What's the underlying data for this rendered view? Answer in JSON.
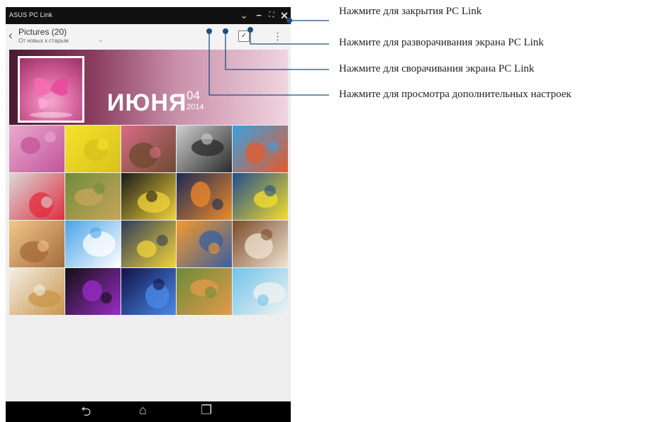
{
  "window": {
    "title": "ASUS PC Link",
    "buttons": {
      "collapse": "⌄",
      "minimize": "−",
      "maximize": "⛶",
      "close": "✕"
    }
  },
  "action_bar": {
    "back_icon": "‹",
    "title": "Pictures (20)",
    "subtitle": "От новых к старым",
    "sort_icon": "⌄",
    "select_icon": "✓",
    "overflow_icon": "⋮"
  },
  "banner": {
    "month": "ИЮНЯ",
    "day": "04",
    "year": "2014"
  },
  "gallery": {
    "tiles": [
      {
        "name": "pink-butterflies",
        "colors": [
          "#e9a9cf",
          "#c2559a"
        ]
      },
      {
        "name": "spongebob",
        "colors": [
          "#f5e22b",
          "#d8c21b"
        ]
      },
      {
        "name": "cupcakes",
        "colors": [
          "#d96c86",
          "#6d4a2f"
        ]
      },
      {
        "name": "clock",
        "colors": [
          "#cfcfcf",
          "#2a2a2a"
        ]
      },
      {
        "name": "hot-air-balloon",
        "colors": [
          "#3aa0e0",
          "#e45b2b"
        ]
      },
      {
        "name": "red-butterfly-stones",
        "colors": [
          "#d9d9d9",
          "#e02d3f"
        ]
      },
      {
        "name": "autumn-alley",
        "colors": [
          "#6f8c3a",
          "#c8a55a"
        ]
      },
      {
        "name": "minion-dark",
        "colors": [
          "#1a1a1a",
          "#f0d33a"
        ]
      },
      {
        "name": "night-park",
        "colors": [
          "#1b2a55",
          "#f08a2a"
        ]
      },
      {
        "name": "banana-logo",
        "colors": [
          "#1f4d8c",
          "#f4dd2b"
        ]
      },
      {
        "name": "eiffel-tower",
        "colors": [
          "#f2c88a",
          "#a46a3c"
        ]
      },
      {
        "name": "olaf",
        "colors": [
          "#4aa3e8",
          "#ffffff"
        ]
      },
      {
        "name": "minions-cartoon",
        "colors": [
          "#2f3c5a",
          "#f2d43a"
        ]
      },
      {
        "name": "minion-sunset",
        "colors": [
          "#f59a2a",
          "#3a5fa0"
        ]
      },
      {
        "name": "heart-coffee",
        "colors": [
          "#7a4a2a",
          "#f0e3d0"
        ]
      },
      {
        "name": "puppy",
        "colors": [
          "#f3efe6",
          "#c9964a"
        ]
      },
      {
        "name": "color-bottles",
        "colors": [
          "#111111",
          "#9b2cc8"
        ]
      },
      {
        "name": "fireworks",
        "colors": [
          "#12124a",
          "#4a8ae8"
        ]
      },
      {
        "name": "kitten",
        "colors": [
          "#6b8c3a",
          "#e39a4a"
        ]
      },
      {
        "name": "seaside",
        "colors": [
          "#6ec4ea",
          "#f2f2f2"
        ]
      }
    ]
  },
  "nav_bar": {
    "back_icon": "⮌",
    "home_icon": "⌂",
    "recent_icon": "❐"
  },
  "callouts": [
    "Нажмите для закрытия PC Link",
    "Нажмите для  разворачивания экрана PC Link",
    "Нажмите для сворачивания экрана PC Link",
    "Нажмите для просмотра дополнительных настроек"
  ],
  "colors": {
    "callout_dot": "#1e4e7c",
    "leader_line": "#1e4e7c"
  }
}
